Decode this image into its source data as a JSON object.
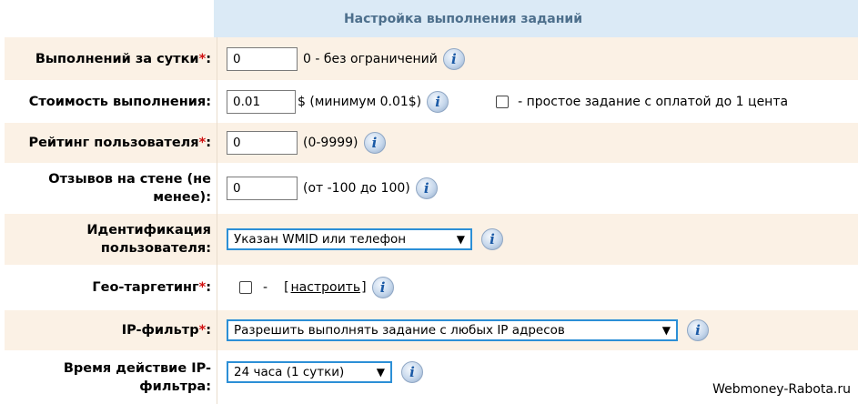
{
  "header": {
    "title": "Настройка выполнения заданий"
  },
  "rows": {
    "executions": {
      "label": "Выполнений за сутки",
      "required": "*",
      "colon": ":",
      "value": "0",
      "hint": "0 - без ограничений",
      "info": "i"
    },
    "cost": {
      "label": "Стоимость выполнения",
      "colon": ":",
      "value": "0.01",
      "hint": "$ (минимум 0.01$)",
      "info": "i",
      "checkbox_label": "- простое задание с оплатой до 1 цента"
    },
    "rating": {
      "label": "Рейтинг пользователя",
      "required": "*",
      "colon": ":",
      "value": "0",
      "hint": "(0-9999)",
      "info": "i"
    },
    "wall": {
      "label": "Отзывов на стене (не менее)",
      "colon": ":",
      "value": "0",
      "hint": "(от -100 до 100)",
      "info": "i"
    },
    "ident": {
      "label": "Идентификация пользователя",
      "colon": ":",
      "selected": "Указан WMID или телефон",
      "info": "i"
    },
    "geo": {
      "label": "Гео-таргетинг",
      "required": "*",
      "colon": ":",
      "dash": "-",
      "open_bracket": "[",
      "link": "настроить",
      "close_bracket": "]",
      "info": "i"
    },
    "ipfilter": {
      "label": "IP-фильтр",
      "required": "*",
      "colon": ":",
      "selected": "Разрешить выполнять задание с любых IP адресов",
      "info": "i"
    },
    "iptime": {
      "label": "Время действие IP-фильтра",
      "colon": ":",
      "selected": "24 часа (1 сутки)",
      "info": "i"
    }
  },
  "watermark": "Webmoney-Rabota.ru"
}
